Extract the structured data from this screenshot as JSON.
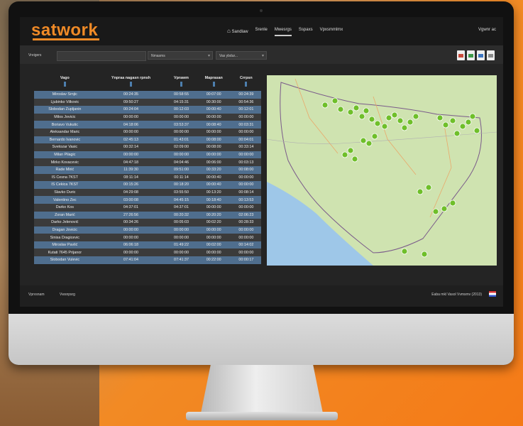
{
  "brand": {
    "logo_text": "satwork",
    "accent": "#f08a26"
  },
  "nav": {
    "items": [
      "Sandlaw",
      "Srenle",
      "Mwesrgs",
      "Sspaxs",
      "Vpxsmmlmx"
    ],
    "active_index": 2,
    "user_label": "Vgwnr ac"
  },
  "toolbar": {
    "search_label": "Vreigers",
    "select1_value": "Nmasms",
    "select2_value": "Vas ybdur..."
  },
  "table": {
    "columns": [
      "Vago",
      "Ynpraa nagasn rpnsh",
      "Vprawm",
      "Maprasan",
      "Crrpsn"
    ],
    "rows": [
      [
        "Miroslav Srnjic",
        "00:24:35",
        "00:58:55",
        "00:07:00",
        "00:24:39"
      ],
      [
        "Ljubinko Vilkovic",
        "09:50:27",
        "04:15:31",
        "00:30:00",
        "00:54:36"
      ],
      [
        "Slobodan Zupljanin",
        "00:24:04",
        "00:12:03",
        "00:00:40",
        "00:12:01"
      ],
      [
        "Milos Jovicic",
        "00:00:00",
        "00:00:00",
        "00:00:00",
        "00:00:00"
      ],
      [
        "Boriavo Vukutic",
        "04:18:06",
        "03:53:37",
        "00:08:40",
        "00:03:31"
      ],
      [
        "Aleksandar Maric",
        "00:00:00",
        "00:00:00",
        "00:00:00",
        "00:00:00"
      ],
      [
        "Bernardo Ivanovic",
        "02:45:13",
        "01:43:01",
        "00:08:00",
        "00:04:01"
      ],
      [
        "Svetozar Vasic",
        "00:32:14",
        "02:09:00",
        "00:08:00",
        "00:33:14"
      ],
      [
        "Milan Pilagic",
        "00:00:00",
        "00:00:00",
        "00:00:00",
        "00:00:00"
      ],
      [
        "Mirko Kovacevic",
        "04:47:18",
        "04:04:46",
        "00:06:00",
        "00:03:13"
      ],
      [
        "Rade Mirić",
        "11:39:30",
        "09:51:00",
        "00:33:20",
        "00:08:00"
      ],
      [
        "IS Cesna 7KST",
        "08:11:14",
        "00:11:14",
        "00:00:40",
        "00:00:00"
      ],
      [
        "IS Cekica 7KST",
        "00:15:26",
        "00:18:20",
        "00:00:40",
        "00:00:00"
      ],
      [
        "Slavko Duric",
        "04:29:08",
        "03:55:50",
        "00:13:20",
        "00:08:14"
      ],
      [
        "Valentino Zec",
        "03:00:08",
        "04:45:15",
        "00:18:40",
        "00:13:53"
      ],
      [
        "Darko Kos",
        "04:37:01",
        "04:37:01",
        "00:00:00",
        "00:00:00"
      ],
      [
        "Zoran Marić",
        "27:26:56",
        "00:20:32",
        "00:20:20",
        "02:06:23"
      ],
      [
        "Darko Jelenović",
        "00:34:26",
        "00:05:03",
        "00:02:20",
        "00:28:33"
      ],
      [
        "Dragan Jovicic",
        "00:00:00",
        "00:00:00",
        "00:00:00",
        "00:00:00"
      ],
      [
        "Sinisa Dragicevic",
        "00:00:00",
        "00:00:00",
        "00:00:00",
        "00:00:00"
      ],
      [
        "Miroslav Pavlić",
        "06:06:18",
        "01:49:22",
        "00:02:00",
        "00:14:02"
      ],
      [
        "Kutati 7645 Prijanor",
        "00:00:00",
        "00:00:00",
        "00:00:00",
        "00:00:00"
      ],
      [
        "Slobodan Vulevic",
        "07:41:04",
        "07:41:37",
        "00:22:00",
        "00:00:17"
      ]
    ]
  },
  "map": {
    "marker_color": "#6fbf2a",
    "land_color": "#cfe3b0",
    "sea_color": "#9ec7e8"
  },
  "footer": {
    "left1": "Vprvsnam",
    "left2": "Vwsnpsrg",
    "right": "Eaba mkl Vasol Vvmsmv (2013)"
  }
}
